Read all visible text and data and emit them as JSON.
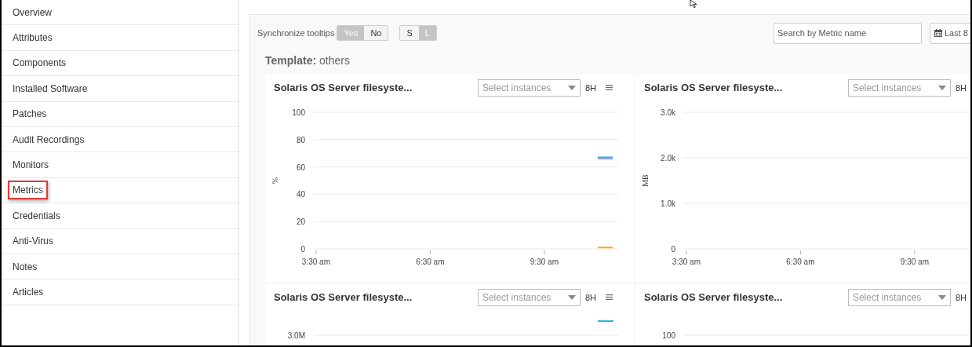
{
  "sidebar": {
    "items": [
      {
        "label": "Overview",
        "selected": false
      },
      {
        "label": "Attributes",
        "selected": false
      },
      {
        "label": "Components",
        "selected": false
      },
      {
        "label": "Installed Software",
        "selected": false
      },
      {
        "label": "Patches",
        "selected": false
      },
      {
        "label": "Audit Recordings",
        "selected": false
      },
      {
        "label": "Monitors",
        "selected": false
      },
      {
        "label": "Metrics",
        "selected": true
      },
      {
        "label": "Credentials",
        "selected": false
      },
      {
        "label": "Anti-Virus",
        "selected": false
      },
      {
        "label": "Notes",
        "selected": false
      },
      {
        "label": "Articles",
        "selected": false
      }
    ]
  },
  "toolbar": {
    "sync_label": "Synchronize tooltips",
    "sync_options": [
      {
        "label": "Yes",
        "selected": true
      },
      {
        "label": "No",
        "selected": false
      }
    ],
    "size_options": [
      {
        "label": "S",
        "selected": false
      },
      {
        "label": "L",
        "selected": true
      }
    ],
    "search": {
      "placeholder": "Search by Metric name"
    },
    "date_button": "Last 8"
  },
  "template": {
    "label": "Template:",
    "name": "others"
  },
  "cards": [
    {
      "title": "Solaris OS Server filesyste...",
      "select_placeholder": "Select instances",
      "range": "8H",
      "menu_icon": true,
      "chart_data": {
        "type": "line",
        "grid": true,
        "ylabel": "%",
        "x": [
          10.9,
          11.3
        ],
        "xlim": [
          3.44,
          11.44
        ],
        "ylim": [
          0,
          100
        ],
        "xticks": [
          {
            "value": 3.5,
            "label": "3:30 am"
          },
          {
            "value": 6.5,
            "label": "6:30 am"
          },
          {
            "value": 9.5,
            "label": "9:30 am"
          }
        ],
        "yticks": [
          0,
          20,
          40,
          60,
          80,
          100
        ],
        "series": [
          {
            "color": "#b39ddb",
            "values": [
              66,
              66
            ]
          },
          {
            "color": "#29b6e6",
            "values": [
              67,
              67
            ]
          },
          {
            "color": "#f0b400",
            "values": [
              1,
              1
            ]
          }
        ]
      }
    },
    {
      "title": "Solaris OS Server filesyste...",
      "select_placeholder": "Select instances",
      "range": "8H",
      "menu_icon": false,
      "chart_data": {
        "type": "line",
        "grid": true,
        "ylabel": "MB",
        "xlim": [
          3.44,
          11.44
        ],
        "ylim": [
          0,
          3000
        ],
        "xticks": [
          {
            "value": 3.5,
            "label": "3:30 am"
          },
          {
            "value": 6.5,
            "label": "6:30 am"
          },
          {
            "value": 9.5,
            "label": "9:30 am"
          }
        ],
        "yticks": [
          0,
          {
            "value": 1000,
            "label": "1.0k"
          },
          {
            "value": 2000,
            "label": "2.0k"
          },
          {
            "value": 3000,
            "label": "3.0k"
          }
        ]
      }
    },
    {
      "title": "Solaris OS Server filesyste...",
      "select_placeholder": "Select instances",
      "range": "8H",
      "menu_icon": true,
      "partial_chart": {
        "top_tick": "3.0M",
        "trace": true
      }
    },
    {
      "title": "Solaris OS Server filesyste...",
      "select_placeholder": "Select instances",
      "range": "8H",
      "menu_icon": false,
      "partial_chart": {
        "top_tick": "100",
        "trace": false
      }
    }
  ]
}
